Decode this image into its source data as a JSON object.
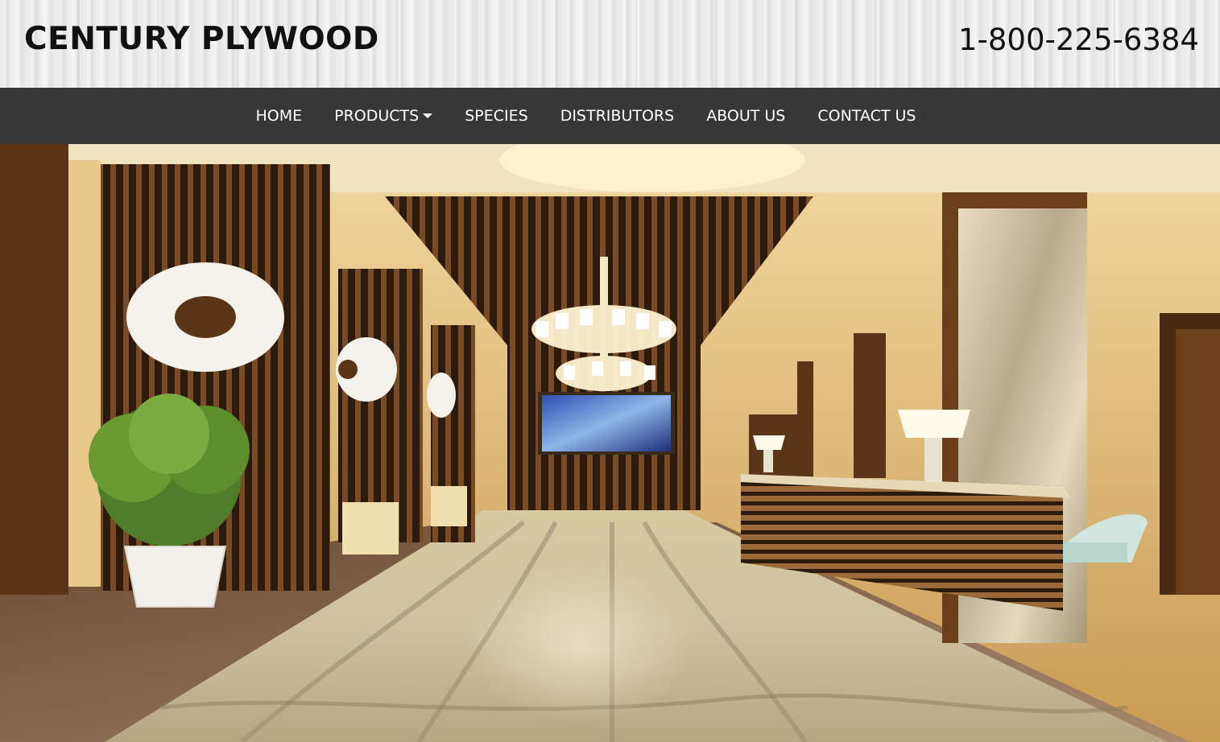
{
  "header": {
    "brand": "CENTURY PLYWOOD",
    "phone": "1-800-225-6384"
  },
  "nav": {
    "items": [
      {
        "label": "HOME",
        "has_dropdown": false
      },
      {
        "label": "PRODUCTS",
        "has_dropdown": true
      },
      {
        "label": "SPECIES",
        "has_dropdown": false
      },
      {
        "label": "DISTRIBUTORS",
        "has_dropdown": false
      },
      {
        "label": "ABOUT US",
        "has_dropdown": false
      },
      {
        "label": "CONTACT US",
        "has_dropdown": false
      }
    ]
  },
  "colors": {
    "nav_bg": "#373737",
    "nav_text": "#ffffff",
    "brand_text": "#111111"
  },
  "hero": {
    "icon": "lobby-interior-image"
  }
}
